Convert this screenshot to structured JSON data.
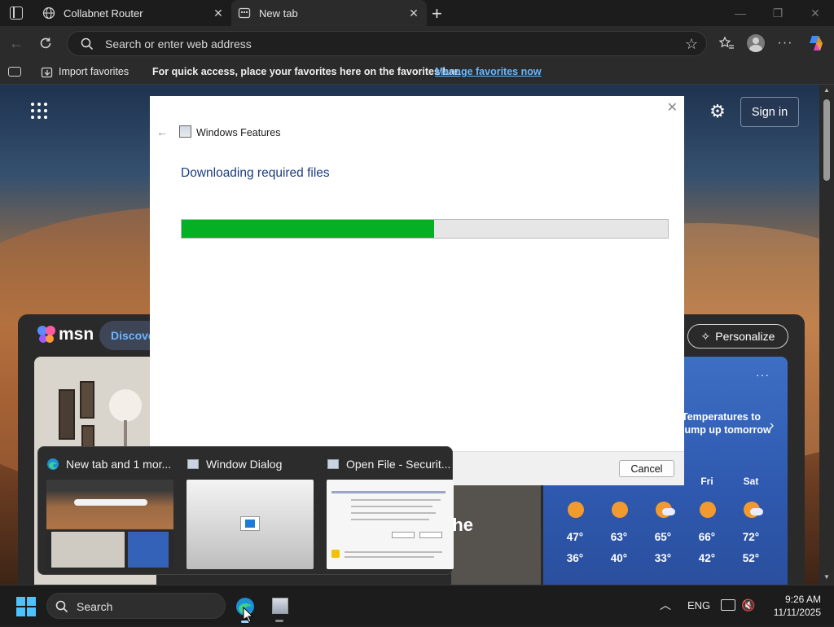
{
  "tabs": [
    {
      "label": "Collabnet Router",
      "icon": "globe-icon",
      "active": false
    },
    {
      "label": "New tab",
      "icon": "newtab-icon",
      "active": true
    }
  ],
  "window_controls": {
    "minimize": "—",
    "restore": "❐",
    "close": "✕"
  },
  "address_bar": {
    "placeholder": "Search or enter web address"
  },
  "favorites_bar": {
    "import_label": "Import favorites",
    "message": "For quick access, place your favorites here on the favorites bar.",
    "manage_link": "Manage favorites now"
  },
  "page": {
    "signin_label": "Sign in",
    "msn_logo": "msn",
    "discover_label": "Discover",
    "personalize_label": "Personalize",
    "weather": {
      "headline": "Temperatures to jump up tomorrow",
      "more": "···",
      "days": [
        {
          "label": "",
          "icon": "sun-icon",
          "hi": "47°",
          "lo": "36°"
        },
        {
          "label": "",
          "icon": "sun-icon",
          "hi": "63°",
          "lo": "40°"
        },
        {
          "label": "",
          "icon": "partly-cloudy-icon",
          "hi": "65°",
          "lo": "33°"
        },
        {
          "label": "Fri",
          "icon": "sun-icon",
          "hi": "66°",
          "lo": "42°"
        },
        {
          "label": "Sat",
          "icon": "partly-cloudy-icon",
          "hi": "72°",
          "lo": "52°"
        }
      ]
    },
    "card_text": "the"
  },
  "dialog": {
    "title": "Windows Features",
    "heading": "Downloading required files",
    "progress_fraction": 0.52,
    "cancel_label": "Cancel",
    "progress_color": "#06b025"
  },
  "taskbar_preview": [
    {
      "title": "New tab and 1 mor...",
      "icon": "edge-icon"
    },
    {
      "title": "Window Dialog",
      "icon": "window-icon"
    },
    {
      "title": "Open File - Securit...",
      "icon": "window-icon"
    }
  ],
  "taskbar": {
    "search_label": "Search",
    "language": "ENG",
    "time": "9:26 AM",
    "date": "11/11/2025"
  }
}
